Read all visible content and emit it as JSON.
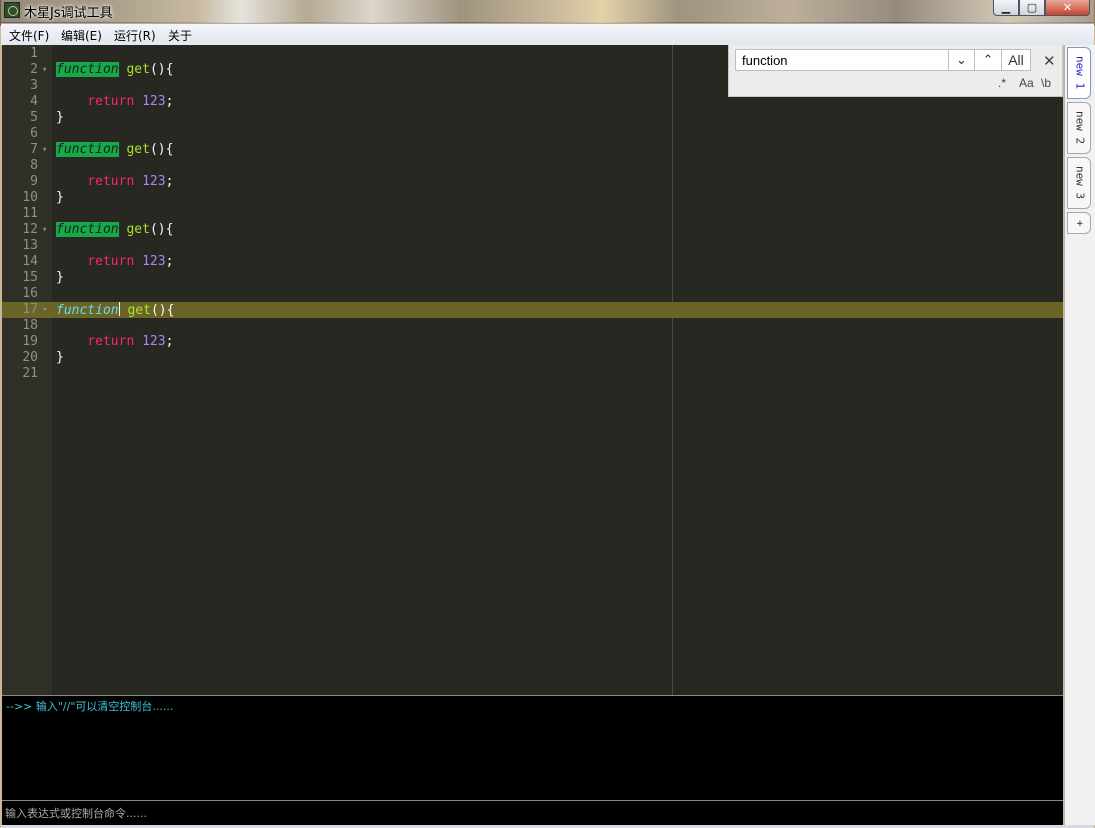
{
  "window": {
    "title": "木星Js调试工具"
  },
  "menu": [
    "文件(F)",
    "编辑(E)",
    "运行(R)",
    "关于"
  ],
  "editor": {
    "lines": [
      {
        "n": "1",
        "code": ""
      },
      {
        "n": "2",
        "code": "function get(){"
      },
      {
        "n": "3",
        "code": ""
      },
      {
        "n": "4",
        "code": "    return 123;"
      },
      {
        "n": "5",
        "code": "}"
      },
      {
        "n": "6",
        "code": ""
      },
      {
        "n": "7",
        "code": "function get(){"
      },
      {
        "n": "8",
        "code": ""
      },
      {
        "n": "9",
        "code": "    return 123;"
      },
      {
        "n": "10",
        "code": "}"
      },
      {
        "n": "11",
        "code": ""
      },
      {
        "n": "12",
        "code": "function get(){"
      },
      {
        "n": "13",
        "code": ""
      },
      {
        "n": "14",
        "code": "    return 123;"
      },
      {
        "n": "15",
        "code": "}"
      },
      {
        "n": "16",
        "code": ""
      },
      {
        "n": "17",
        "code": "function get(){"
      },
      {
        "n": "18",
        "code": ""
      },
      {
        "n": "19",
        "code": "    return 123;"
      },
      {
        "n": "20",
        "code": "}"
      },
      {
        "n": "21",
        "code": ""
      }
    ],
    "active_line": 17
  },
  "find": {
    "value": "function",
    "all_label": "All",
    "regex_label": ".*",
    "case_label": "Aa",
    "word_label": "\\b"
  },
  "tabs": [
    {
      "label": "new 1",
      "active": true
    },
    {
      "label": "new 2",
      "active": false
    },
    {
      "label": "new 3",
      "active": false
    },
    {
      "label": "+",
      "active": false
    }
  ],
  "console": {
    "hint": "-->> 输入\"//\"可以清空控制台......"
  },
  "command": {
    "placeholder": "输入表达式或控制台命令......"
  },
  "colors": {
    "editor_bg": "#272822",
    "keyword": "#66d9ef",
    "function_name": "#a6e22e",
    "return": "#f92672",
    "number": "#ae81ff",
    "match_highlight": "#18a84a",
    "active_line": "#6a6526",
    "console_text": "#3ec2d8"
  }
}
